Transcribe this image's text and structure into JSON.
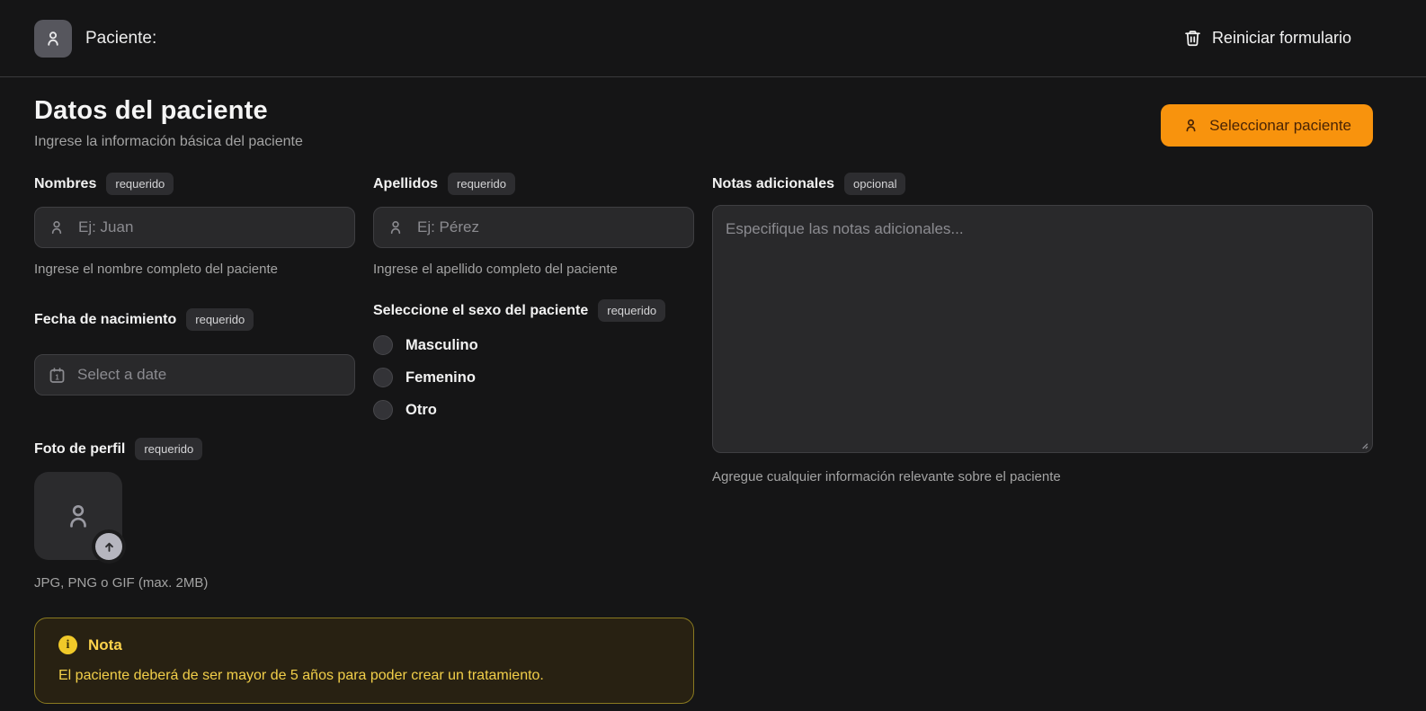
{
  "colors": {
    "background": "#151516",
    "accent_orange": "#f8930d",
    "accent_text": "#4a2405",
    "note_background": "#282112",
    "note_border": "#8a7a20",
    "note_text": "#f2cf49"
  },
  "topbar": {
    "patient_label": "Paciente:",
    "reset_label": "Reiniciar formulario"
  },
  "header": {
    "title": "Datos del paciente",
    "subtitle": "Ingrese la información básica del paciente",
    "select_patient_label": "Seleccionar paciente"
  },
  "fields": {
    "nombres": {
      "label": "Nombres",
      "badge": "requerido",
      "placeholder": "Ej: Juan",
      "helper": "Ingrese el nombre completo del paciente"
    },
    "apellidos": {
      "label": "Apellidos",
      "badge": "requerido",
      "placeholder": "Ej: Pérez",
      "helper": "Ingrese el apellido completo del paciente"
    },
    "fecha_nacimiento": {
      "label": "Fecha de nacimiento",
      "badge": "requerido",
      "placeholder": "Select a date"
    },
    "sexo": {
      "label": "Seleccione el sexo del paciente",
      "badge": "requerido",
      "options": [
        "Masculino",
        "Femenino",
        "Otro"
      ]
    },
    "foto": {
      "label": "Foto de perfil",
      "badge": "requerido",
      "helper": "JPG, PNG o GIF (max. 2MB)"
    },
    "notas": {
      "label": "Notas adicionales",
      "badge": "opcional",
      "placeholder": "Especifique las notas adicionales...",
      "helper": "Agregue cualquier información relevante sobre el paciente"
    }
  },
  "note": {
    "title": "Nota",
    "body": "El paciente deberá de ser mayor de 5 años para poder crear un tratamiento."
  }
}
